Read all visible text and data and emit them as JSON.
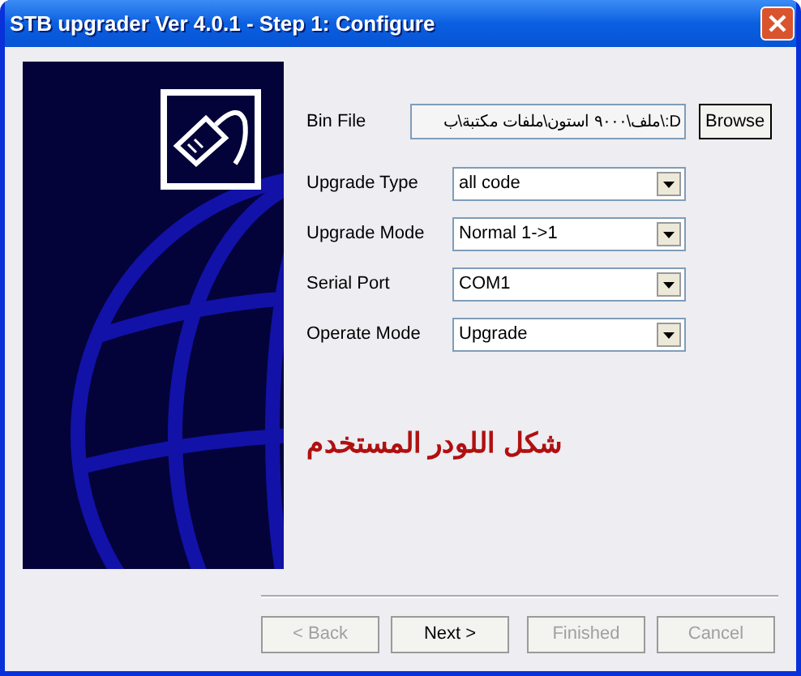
{
  "window": {
    "title": "STB upgrader Ver 4.0.1 - Step 1: Configure"
  },
  "bin_file": {
    "label": "Bin File",
    "value": "D:\\ملف\\٩٠٠٠ استون\\ملفات مكتبة\\ب",
    "button": "Browse"
  },
  "fields": [
    {
      "label": "Upgrade Type",
      "value": "all code"
    },
    {
      "label": "Upgrade Mode",
      "value": "Normal 1->1"
    },
    {
      "label": "Serial Port",
      "value": "COM1"
    },
    {
      "label": "Operate Mode",
      "value": "Upgrade"
    }
  ],
  "caption": "شكل اللودر المستخدم",
  "buttons": [
    {
      "label": "< Back",
      "disabled": true
    },
    {
      "label": "Next >",
      "disabled": false
    },
    {
      "label": "Finished",
      "disabled": true
    },
    {
      "label": "Cancel",
      "disabled": true
    }
  ]
}
